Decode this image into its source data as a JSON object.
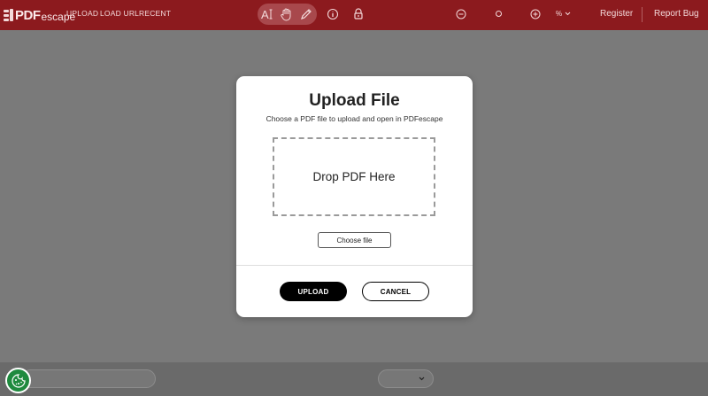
{
  "app": {
    "logo_pdf": "PDF",
    "logo_escape": "escape"
  },
  "nav": {
    "upload": "UPLOAD",
    "load_url": "LOAD URL",
    "recent": "RECENT"
  },
  "toolbar": {
    "text_tool_icon": "text-tool-icon",
    "hand_tool_icon": "hand-icon",
    "pencil_tool_icon": "pencil-icon",
    "info_icon": "info-icon",
    "lock_icon": "lock-icon",
    "zoom_out_icon": "zoom-out-icon",
    "zoom_in_icon": "zoom-in-icon",
    "zoom_level": "%"
  },
  "account": {
    "register": "Register",
    "report_bug": "Report Bug"
  },
  "modal": {
    "title": "Upload File",
    "subtitle": "Choose a PDF file to upload and open in PDFescape",
    "dropzone_text": "Drop PDF Here",
    "choose_file": "Choose file",
    "upload_button": "UPLOAD",
    "cancel_button": "CANCEL"
  },
  "colors": {
    "topbar": "#8c1a1e",
    "backdrop": "#7a7a7a",
    "cookie_button": "#1f8a3e"
  }
}
